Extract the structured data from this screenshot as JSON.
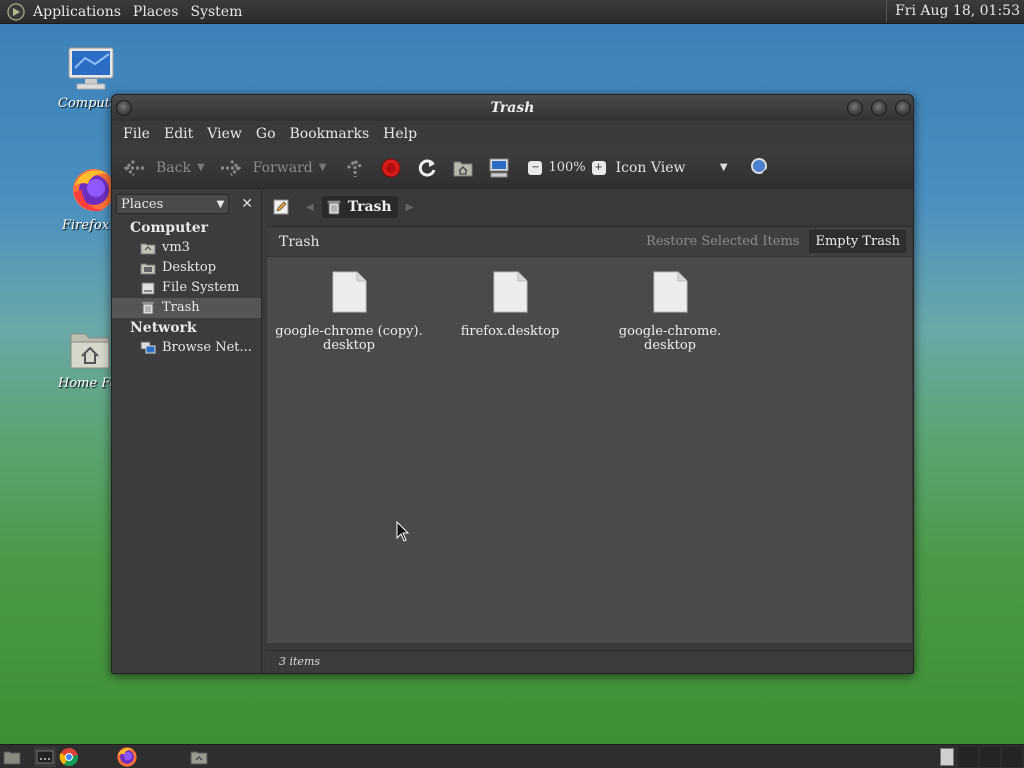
{
  "top_panel": {
    "menus": [
      "Applications",
      "Places",
      "System"
    ],
    "clock": "Fri Aug 18, 01:53"
  },
  "desktop_icons": [
    {
      "label": "Computer",
      "icon": "monitor-icon"
    },
    {
      "label": "Firefox",
      "icon": "firefox-icon"
    },
    {
      "label": "Home Folder",
      "icon": "home-folder-icon"
    }
  ],
  "window": {
    "title": "Trash",
    "menubar": [
      "File",
      "Edit",
      "View",
      "Go",
      "Bookmarks",
      "Help"
    ],
    "toolbar": {
      "back_label": "Back",
      "forward_label": "Forward",
      "zoom_level": "100%",
      "view_mode": "Icon View"
    },
    "sidebar": {
      "selector_label": "Places",
      "sections": [
        {
          "heading": "Computer",
          "items": [
            {
              "label": "vm3",
              "icon": "home-folder-icon",
              "selected": false
            },
            {
              "label": "Desktop",
              "icon": "desktop-folder-icon",
              "selected": false
            },
            {
              "label": "File System",
              "icon": "drive-icon",
              "selected": false
            },
            {
              "label": "Trash",
              "icon": "trash-icon",
              "selected": true
            }
          ]
        },
        {
          "heading": "Network",
          "items": [
            {
              "label": "Browse Net...",
              "icon": "network-icon",
              "selected": false
            }
          ]
        }
      ]
    },
    "location": {
      "crumb": "Trash"
    },
    "trash_bar": {
      "title": "Trash",
      "restore_label": "Restore Selected Items",
      "empty_label": "Empty Trash"
    },
    "files": [
      {
        "line1": "google-chrome (copy).",
        "line2": "desktop"
      },
      {
        "line1": "firefox.desktop",
        "line2": ""
      },
      {
        "line1": "google-chrome.",
        "line2": "desktop"
      }
    ],
    "status": "3 items"
  },
  "colors": {
    "window_bg": "#3a3a3a",
    "content_bg": "#4a4a4a",
    "stop_red": "#d81c1c",
    "text_light": "#e8e8e8"
  }
}
